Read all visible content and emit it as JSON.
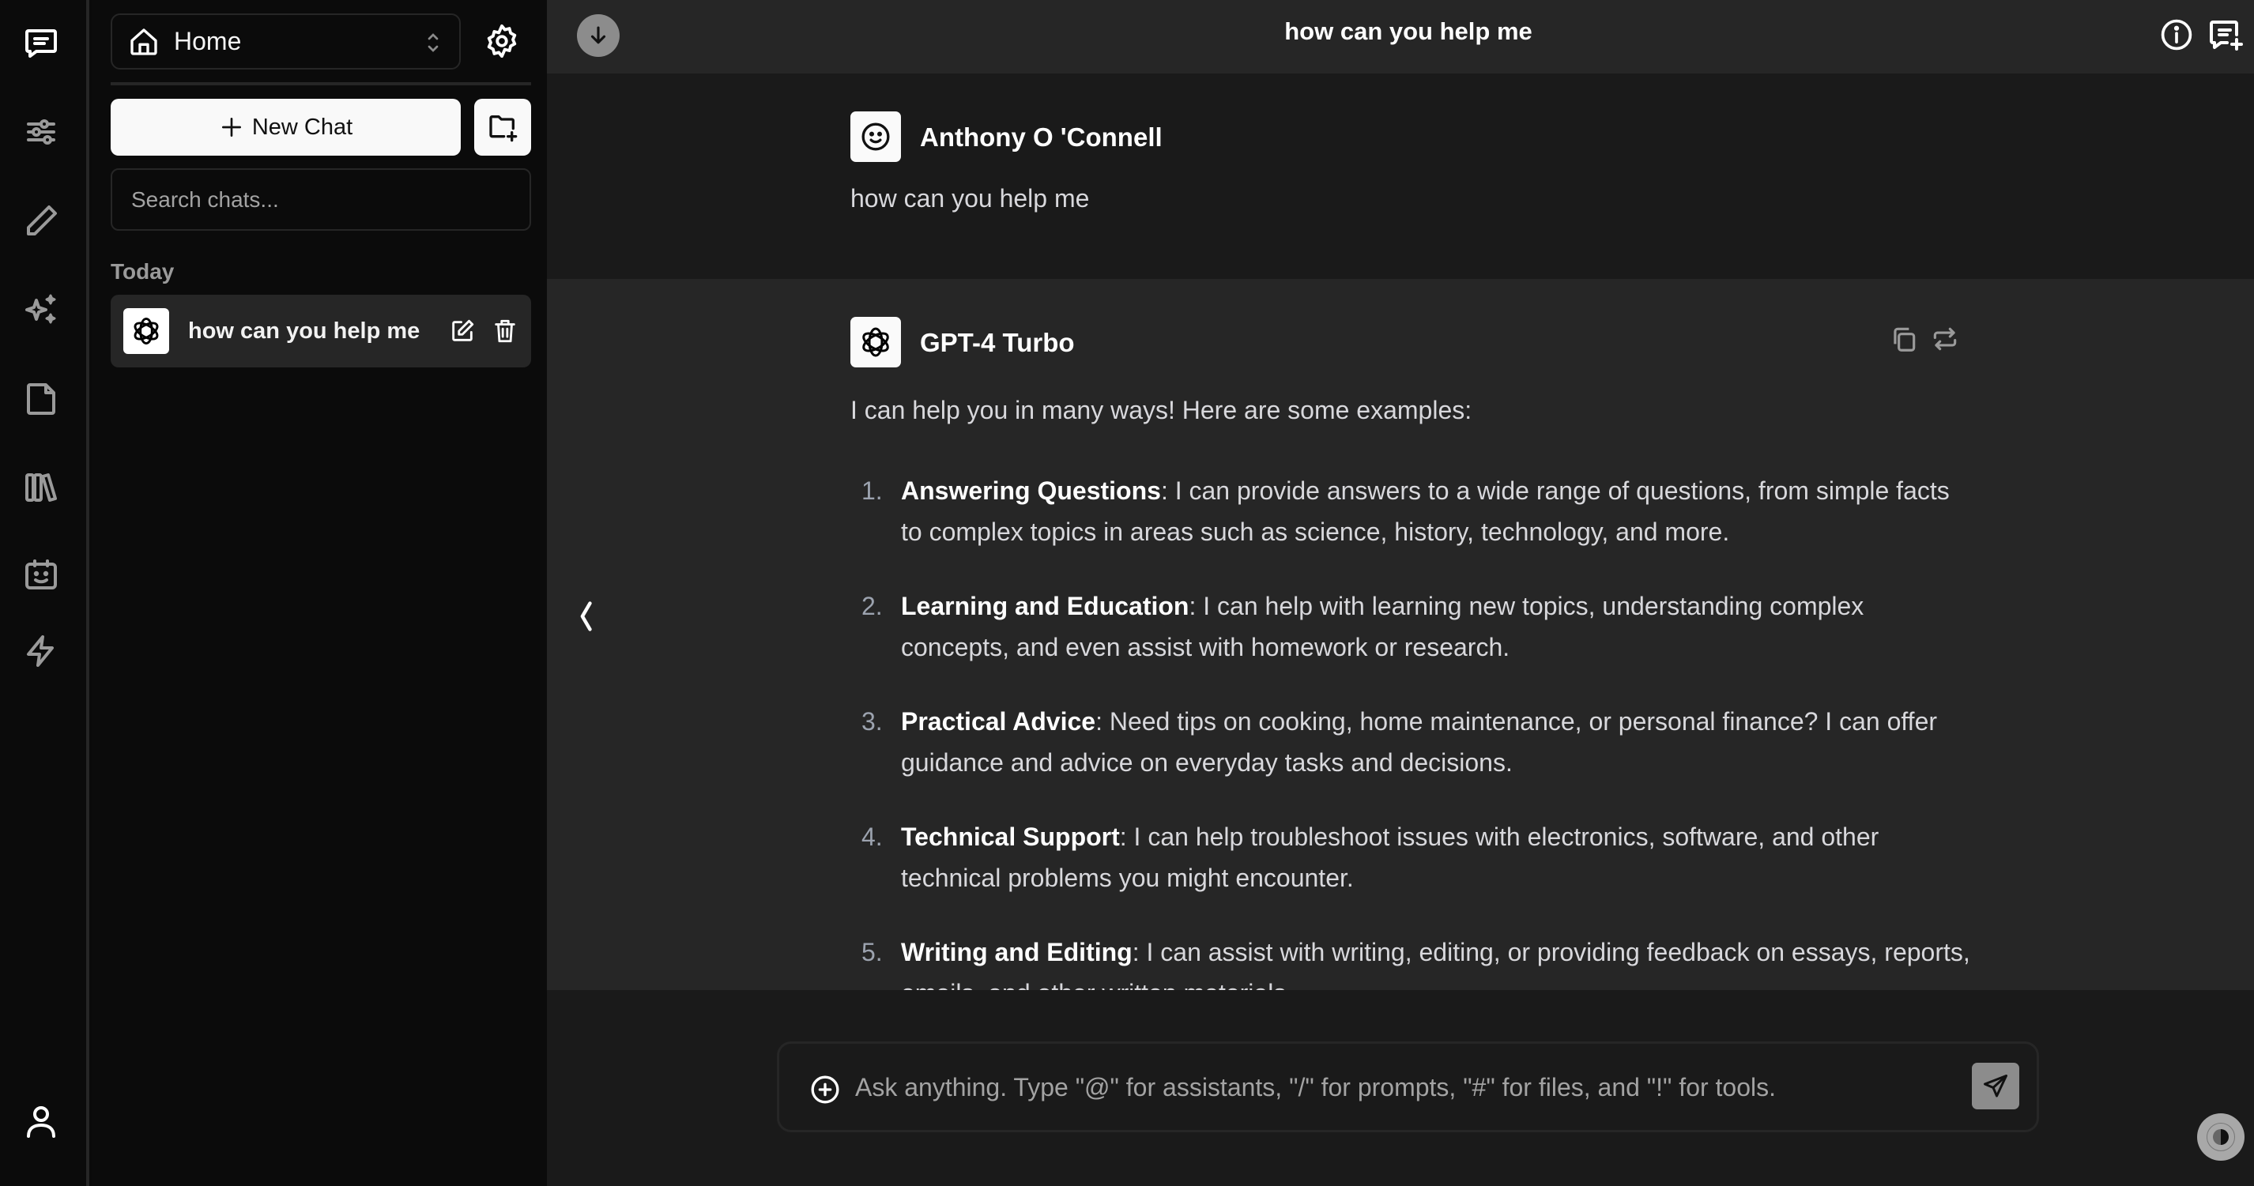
{
  "rail": {
    "items": [
      {
        "name": "chats",
        "icon": "message-square-icon",
        "active": true
      },
      {
        "name": "parameters",
        "icon": "sliders-icon"
      },
      {
        "name": "prompts",
        "icon": "pencil-icon"
      },
      {
        "name": "assistants",
        "icon": "sparkles-icon"
      },
      {
        "name": "files",
        "icon": "file-icon"
      },
      {
        "name": "collections",
        "icon": "library-icon"
      },
      {
        "name": "models",
        "icon": "bot-icon"
      },
      {
        "name": "tools",
        "icon": "bolt-icon"
      }
    ],
    "profile_icon": "user-icon"
  },
  "sidebar": {
    "workspace": "Home",
    "new_chat_label": "New Chat",
    "search_placeholder": "Search chats...",
    "sections": [
      {
        "label": "Today",
        "chats": [
          {
            "title": "how can you help me",
            "model_icon": "openai-logo-icon"
          }
        ]
      }
    ]
  },
  "header": {
    "title": "how can you help me"
  },
  "messages": [
    {
      "role": "user",
      "sender": "Anthony O 'Connell",
      "text": "how can you help me"
    },
    {
      "role": "assistant",
      "sender": "GPT-4 Turbo",
      "intro": "I can help you in many ways! Here are some examples:",
      "items": [
        {
          "num": "1.",
          "title": "Answering Questions",
          "text": ": I can provide answers to a wide range of questions, from simple facts to complex topics in areas such as science, history, technology, and more."
        },
        {
          "num": "2.",
          "title": "Learning and Education",
          "text": ": I can help with learning new topics, understanding complex concepts, and even assist with homework or research."
        },
        {
          "num": "3.",
          "title": "Practical Advice",
          "text": ": Need tips on cooking, home maintenance, or personal finance? I can offer guidance and advice on everyday tasks and decisions."
        },
        {
          "num": "4.",
          "title": "Technical Support",
          "text": ": I can help troubleshoot issues with electronics, software, and other technical problems you might encounter."
        },
        {
          "num": "5.",
          "title": "Writing and Editing",
          "text": ": I can assist with writing, editing, or providing feedback on essays, reports, emails, and other written materials."
        }
      ]
    }
  ],
  "composer": {
    "placeholder": "Ask anything. Type \"@\" for assistants, \"/\" for prompts, \"#\" for files, and \"!\" for tools.",
    "value": ""
  },
  "colors": {
    "rail_bg": "#0b0b0b",
    "header_bg": "#262626",
    "user_msg_bg": "#1a1a1a",
    "assistant_msg_bg": "#262626",
    "send_button": "#8c8c8c"
  }
}
